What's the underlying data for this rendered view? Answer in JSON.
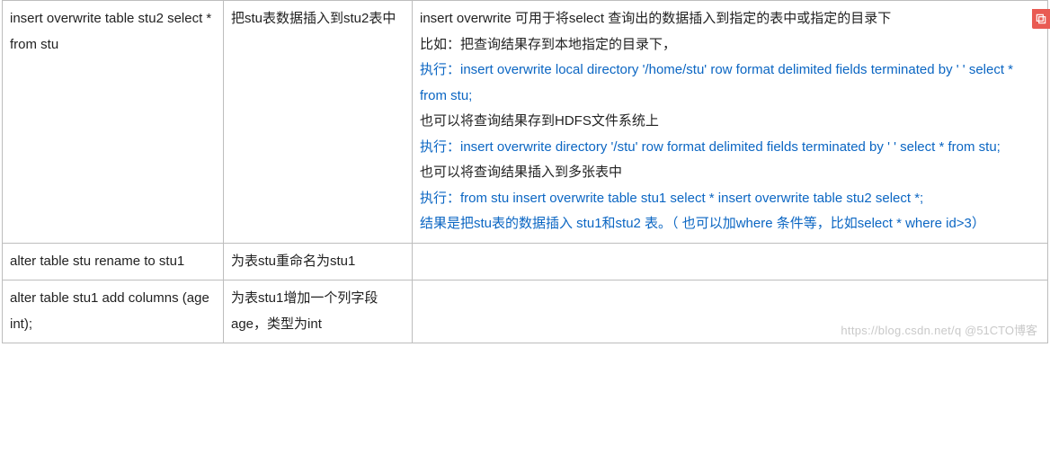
{
  "rows": [
    {
      "command": "insert  overwrite  table stu2  select * from stu",
      "desc": "把stu表数据插入到stu2表中",
      "explain": [
        {
          "type": "line",
          "parts": [
            {
              "cls": "black",
              "text": "insert  overwrite 可用于将select 查询出的数据插入到指定的表中或指定的目录下"
            }
          ]
        },
        {
          "type": "line",
          "parts": [
            {
              "cls": "black",
              "text": "比如：把查询结果存到本地指定的目录下，"
            }
          ]
        },
        {
          "type": "line",
          "parts": [
            {
              "cls": "blue",
              "text": "执行：insert overwrite local directory '/home/stu' row format delimited fields terminated by ' ' select * from stu;"
            }
          ]
        },
        {
          "type": "line",
          "parts": [
            {
              "cls": "black",
              "text": "也可以将查询结果存到HDFS文件系统上"
            }
          ]
        },
        {
          "type": "line",
          "parts": [
            {
              "cls": "blue",
              "text": "执行：insert overwrite directory '/stu' row format delimited fields terminated by ' '  select * from stu;"
            }
          ]
        },
        {
          "type": "line",
          "parts": [
            {
              "cls": "black",
              "text": "也可以将查询结果插入到多张表中"
            }
          ]
        },
        {
          "type": "line",
          "parts": [
            {
              "cls": "blue",
              "text": "执行：from stu insert overwrite table stu1 select * insert overwrite table stu2 select *;"
            }
          ]
        },
        {
          "type": "line",
          "parts": [
            {
              "cls": "blue",
              "text": "结果是把stu表的数据插入 stu1和stu2 表。（ 也可以加where 条件等，比如select * where id>3）"
            }
          ]
        }
      ]
    },
    {
      "command": "alter table  stu rename to stu1",
      "desc": "为表stu重命名为stu1",
      "explain": []
    },
    {
      "command": "alter table stu1 add columns (age int);",
      "desc": "为表stu1增加一个列字段age，类型为int",
      "explain": []
    }
  ],
  "watermark": {
    "pre": "https://blog.csdn.net/q",
    "post": "@51CTO博客"
  },
  "badge_icon": "image-overlay-icon"
}
